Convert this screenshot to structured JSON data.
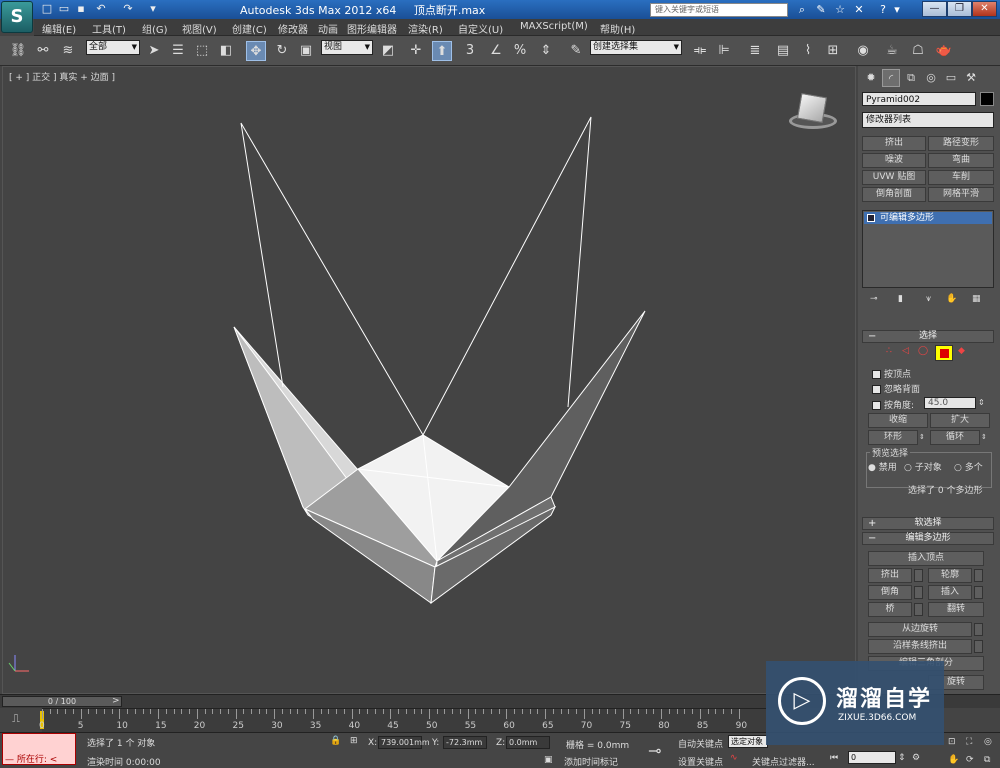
{
  "app": {
    "title": "Autodesk 3ds Max  2012 x64",
    "filename": "顶点断开.max",
    "search_placeholder": "键入关键字或短语",
    "logo_glyph": "S"
  },
  "menu": [
    "编辑(E)",
    "工具(T)",
    "组(G)",
    "视图(V)",
    "创建(C)",
    "修改器",
    "动画",
    "图形编辑器",
    "渲染(R)",
    "自定义(U)",
    "MAXScript(M)",
    "帮助(H)"
  ],
  "toolbar": {
    "selection_filter": "全部",
    "reference_coord": "视图",
    "named_selection": "创建选择集",
    "snap_label": "3"
  },
  "viewport": {
    "label": "[ + ] 正交 ] 真实 + 边面 ]"
  },
  "panel": {
    "object_name": "Pyramid002",
    "modifier_list": "修改器列表",
    "modifier_buttons": [
      [
        "挤出",
        "路径变形"
      ],
      [
        "噪波",
        "弯曲"
      ],
      [
        "UVW 贴图",
        "车削"
      ],
      [
        "倒角剖面",
        "网格平滑"
      ]
    ],
    "stack_item": "可编辑多边形",
    "selection_rollout": "选择",
    "by_vertex": "按顶点",
    "ignore_backfacing": "忽略背面",
    "by_angle": "按角度:",
    "angle_value": "45.0",
    "shrink": "收缩",
    "grow": "扩大",
    "ring": "环形",
    "loop": "循环",
    "preview_selection": "预览选择",
    "preview_options": [
      "禁用",
      "子对象",
      "多个"
    ],
    "selected_info": "选择了 0 个多边形",
    "soft_selection": "软选择",
    "edit_polygons": "编辑多边形",
    "insert_vertex": "插入顶点",
    "edit_buttons": [
      [
        "挤出",
        "轮廓"
      ],
      [
        "倒角",
        "插入"
      ],
      [
        "桥",
        "翻转"
      ]
    ],
    "hinge_from_edge": "从边旋转",
    "extrude_along_spline": "沿样条线挤出",
    "edit_triangulation": "编辑三角剖分",
    "rotate": "旋转"
  },
  "timeline": {
    "frame_display": "0 / 100",
    "ticks": [
      "0",
      "5",
      "10",
      "15",
      "20",
      "25",
      "30",
      "35",
      "40",
      "45",
      "50",
      "55",
      "60",
      "65",
      "70",
      "75",
      "80",
      "85",
      "90"
    ]
  },
  "status": {
    "script_label": "所在行:",
    "selected_text": "选择了 1 个 对象",
    "render_time": "渲染时间  0:00:00",
    "x_label": "X:",
    "x_value": "739.001mm",
    "y_label": "Y:",
    "y_value": "-72.3mm",
    "z_label": "Z:",
    "z_value": "0.0mm",
    "grid": "栅格 = 0.0mm",
    "add_time_tag": "添加时间标记",
    "auto_key": "自动关键点",
    "set_key": "设置关键点",
    "selected_object": "选定对象",
    "key_filters": "关键点过滤器...",
    "current_frame": "0"
  },
  "watermark": {
    "title": "溜溜自学",
    "url": "ZIXUE.3D66.COM"
  }
}
